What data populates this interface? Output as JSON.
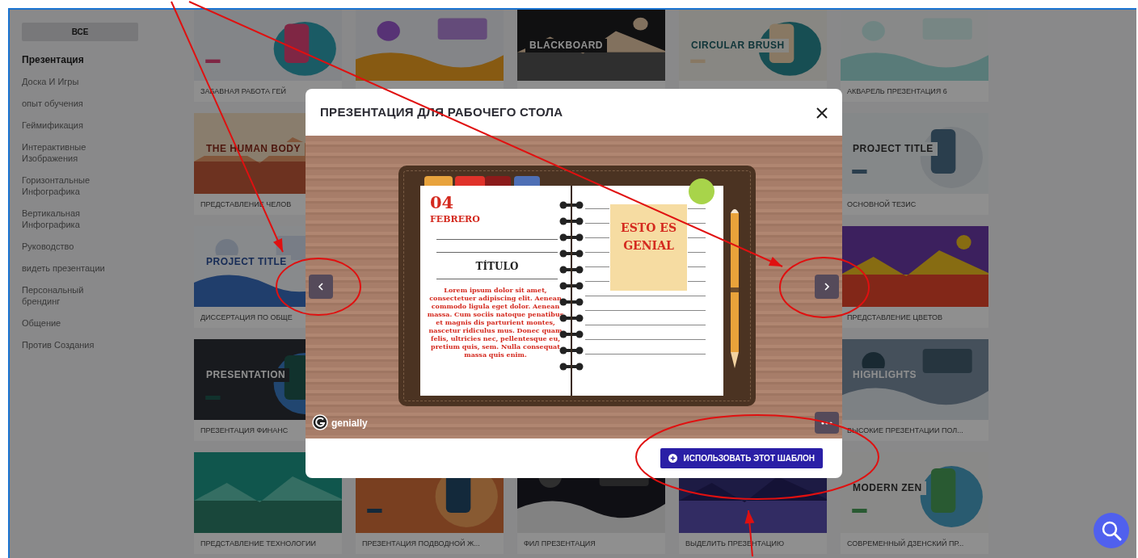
{
  "sidebar": {
    "button": "ВСЕ",
    "items": [
      {
        "label": "Презентация",
        "selected": true
      },
      {
        "label": "Доска И Игры",
        "selected": false
      },
      {
        "label": "опыт обучения",
        "selected": false
      },
      {
        "label": "Геймификация",
        "selected": false
      },
      {
        "label": "Интерактивные Изображения",
        "selected": false
      },
      {
        "label": "Горизонтальные Инфографика",
        "selected": false
      },
      {
        "label": "Вертикальная Инфографика",
        "selected": false
      },
      {
        "label": "Руководство",
        "selected": false
      },
      {
        "label": "видеть презентации",
        "selected": false
      },
      {
        "label": "Персональный брендинг",
        "selected": false
      },
      {
        "label": "Общение",
        "selected": false
      },
      {
        "label": "Против Создания",
        "selected": false
      }
    ]
  },
  "grid": {
    "rows": [
      {
        "cards": [
          {
            "kind": "picture",
            "caption": "ЗАБАВНАЯ РАБОТА ГЕЙ"
          },
          {
            "kind": "picture"
          },
          {
            "kind": "picture",
            "title": "BLACKBOARD"
          },
          {
            "kind": "picture",
            "title": "CIRCULAR BRUSH"
          },
          {
            "kind": "picture",
            "caption": "АКВАРЕЛЬ ПРЕЗЕНТАЦИЯ 6"
          }
        ]
      },
      {
        "cards": [
          {
            "kind": "picture",
            "title": "THE HUMAN BODY",
            "caption": "ПРЕДСТАВЛЕНИЕ ЧЕЛОВ"
          },
          {
            "kind": "picture",
            "title": "PROJECT TITLE",
            "caption": "ОСНОВНОЙ ТЕЗИС"
          }
        ]
      },
      {
        "cards": [
          {
            "kind": "picture",
            "title": "PROJECT TITLE",
            "caption": "ДИССЕРТАЦИЯ ПО ОБЩЕ"
          },
          {
            "kind": "picture",
            "caption": "ПРЕДСТАВЛЕНИЕ ЦВЕТОВ"
          }
        ]
      },
      {
        "cards": [
          {
            "kind": "picture",
            "title": "PRESENTATION",
            "caption": "ПРЕЗЕНТАЦИЯ ФИНАНС"
          },
          {
            "kind": "picture",
            "title": "HIGHLIGHTS",
            "caption": "ВЫСОКИЕ ПРЕЗЕНТАЦИИ ПОЛ..."
          }
        ]
      },
      {
        "cards": [
          {
            "kind": "picture",
            "caption": "ПРЕДСТАВЛЕНИЕ ТЕХНОЛОГИИ"
          },
          {
            "kind": "picture",
            "caption": "ПРЕЗЕНТАЦИЯ ПОДВОДНОЙ Ж..."
          },
          {
            "kind": "picture",
            "caption": "ФИЛ ПРЕЗЕНТАЦИЯ"
          },
          {
            "kind": "picture",
            "caption": "ВЫДЕЛИТЬ ПРЕЗЕНТАЦИЮ"
          },
          {
            "kind": "picture",
            "title": "MODERN ZEN",
            "caption": "СОВРЕМЕННЫЙ ДЗЕНСКИЙ ПР..."
          }
        ]
      }
    ]
  },
  "modal": {
    "title": "ПРЕЗЕНТАЦИЯ ДЛЯ РАБОЧЕГО СТОЛА",
    "slide": {
      "day": "04",
      "month": "FEBRERO",
      "heading": "TÍTULO",
      "body": "Lorem ipsum dolor sit amet, consectetuer adipiscing elit. Aenean commodo ligula eget dolor. Aenean massa. Cum sociis natoque penatibus et magnis dis parturient montes, nascetur ridiculus mus. Donec quam felis, ultricies nec, pellentesque eu, pretium quis, sem. Nulla consequat massa quis enim.",
      "note": "ESTO ES GENIAL",
      "brand": "genially"
    },
    "use_button": "ИСПОЛЬЗОВАТЬ ЭТОТ ШАБЛОН"
  }
}
